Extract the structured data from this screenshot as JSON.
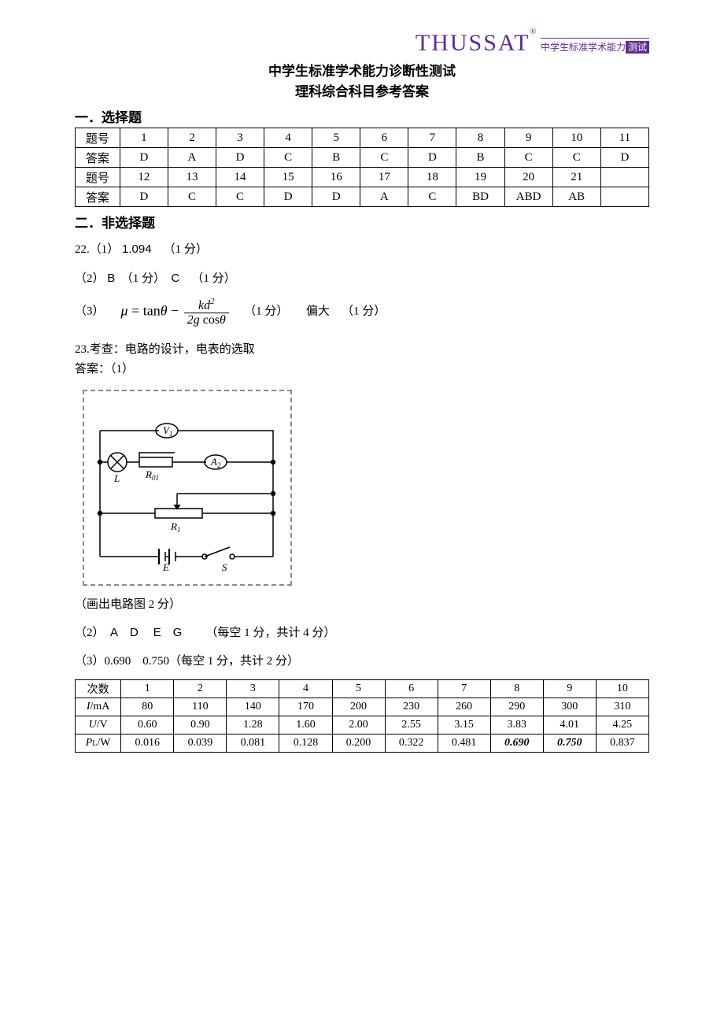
{
  "logo": {
    "main": "THUSSAT",
    "r": "®",
    "sub_cn": "中学生标准学术能力",
    "sub_badge": "测试"
  },
  "titles": {
    "t1": "中学生标准学术能力诊断性测试",
    "t2": "理科综合科目参考答案"
  },
  "section1": "一．选择题",
  "section2": "二．非选择题",
  "mc": {
    "h_q": "题号",
    "h_a": "答案",
    "q1": [
      "1",
      "2",
      "3",
      "4",
      "5",
      "6",
      "7",
      "8",
      "9",
      "10",
      "11"
    ],
    "a1": [
      "D",
      "A",
      "D",
      "C",
      "B",
      "C",
      "D",
      "B",
      "C",
      "C",
      "D"
    ],
    "q2": [
      "12",
      "13",
      "14",
      "15",
      "16",
      "17",
      "18",
      "19",
      "20",
      "21",
      ""
    ],
    "a2": [
      "D",
      "C",
      "C",
      "D",
      "D",
      "A",
      "C",
      "BD",
      "ABD",
      "AB",
      ""
    ]
  },
  "q22": {
    "l1a": "22.（1）",
    "l1b": "1.094",
    "l1c": "（1 分）",
    "l2a": "（2）",
    "l2b": "B",
    "l2c": "（1 分）",
    "l2d": "C",
    "l2e": "（1 分）",
    "l3a": "（3）",
    "fm_mu": "μ",
    "fm_eq": " = tan",
    "fm_th": "θ",
    "fm_minus": " − ",
    "fm_num_k": "kd",
    "fm_num_sq": "2",
    "fm_den": "2g cosθ",
    "l3c": "（1 分）",
    "l3d": "偏大",
    "l3e": "（1 分）"
  },
  "q23": {
    "intro": "23.考查：电路的设计，电表的选取",
    "ans": "答案：（1）",
    "labels": {
      "V1": "V",
      "V1s": "1",
      "A2": "A",
      "A2s": "2",
      "L": "L",
      "R01": "R",
      "R01s": "01",
      "R1": "R",
      "R1s": "1",
      "E": "E",
      "S": "S"
    },
    "note1": "（画出电路图 2 分）",
    "l2a": "（2）",
    "l2b": "A",
    "l2c": "D",
    "l2d": "E",
    "l2e": "G",
    "l2f": "（每空 1 分，共计 4 分）",
    "l3a": "（3）0.690",
    "l3b": "0.750（每空 1 分，共计 2 分）"
  },
  "tbl": {
    "h": "次数",
    "cols": [
      "1",
      "2",
      "3",
      "4",
      "5",
      "6",
      "7",
      "8",
      "9",
      "10"
    ],
    "r_i_h": "I/mA",
    "r_i": [
      "80",
      "110",
      "140",
      "170",
      "200",
      "230",
      "260",
      "290",
      "300",
      "310"
    ],
    "r_u_h": "U/V",
    "r_u": [
      "0.60",
      "0.90",
      "1.28",
      "1.60",
      "2.00",
      "2.55",
      "3.15",
      "3.83",
      "4.01",
      "4.25"
    ],
    "r_p_h_i": "P",
    "r_p_h_s": "L",
    "r_p_h_u": "/W",
    "r_p": [
      "0.016",
      "0.039",
      "0.081",
      "0.128",
      "0.200",
      "0.322",
      "0.481",
      "0.690",
      "0.750",
      "0.837"
    ]
  }
}
